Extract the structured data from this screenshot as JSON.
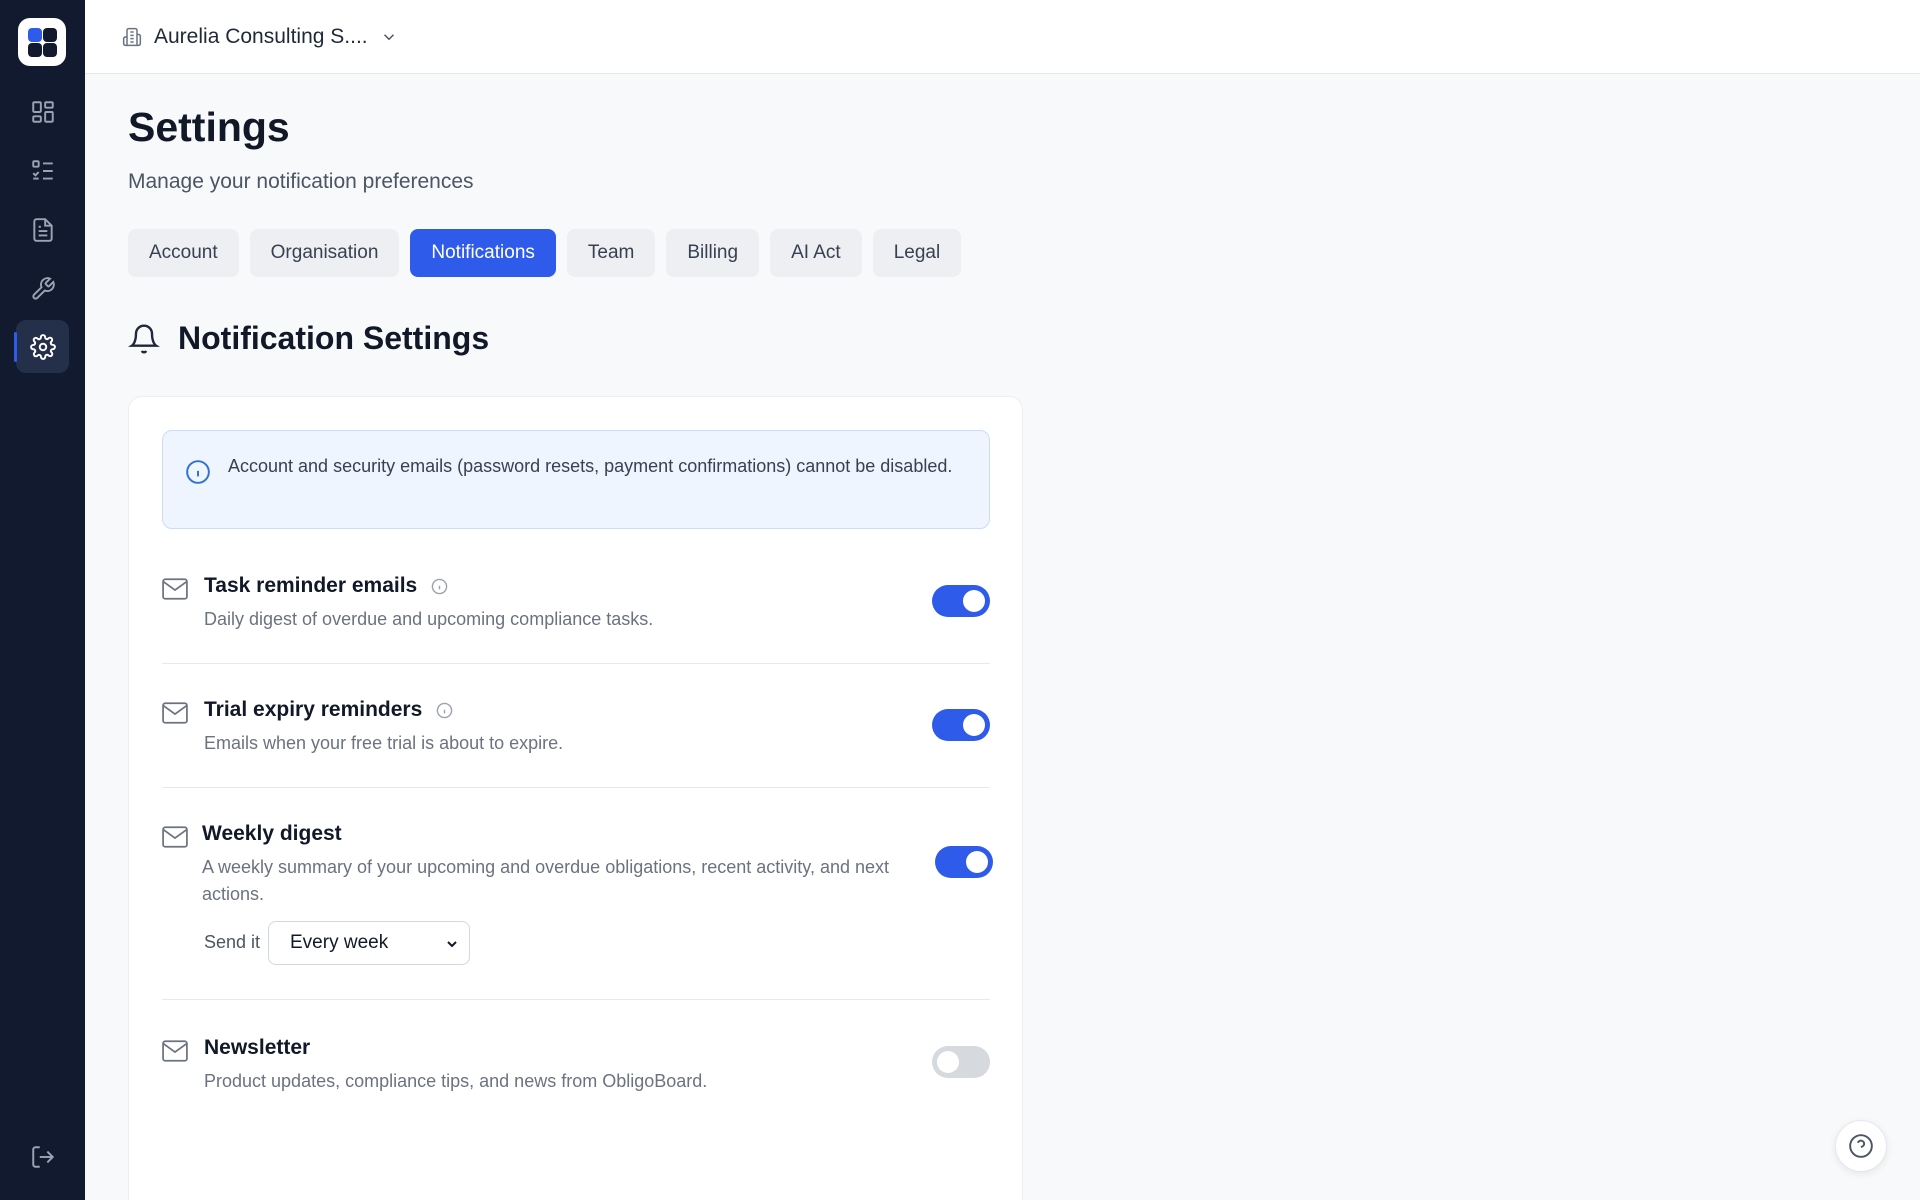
{
  "topbar": {
    "org_name": "Aurelia Consulting S...."
  },
  "page": {
    "title": "Settings",
    "subtitle": "Manage your notification preferences"
  },
  "tabs": [
    {
      "label": "Account",
      "active": false
    },
    {
      "label": "Organisation",
      "active": false
    },
    {
      "label": "Notifications",
      "active": true
    },
    {
      "label": "Team",
      "active": false
    },
    {
      "label": "Billing",
      "active": false
    },
    {
      "label": "AI Act",
      "active": false
    },
    {
      "label": "Legal",
      "active": false
    }
  ],
  "section": {
    "title": "Notification Settings"
  },
  "info_notice": "Account and security emails (password resets, payment confirmations) cannot be disabled.",
  "settings": [
    {
      "title": "Task reminder emails",
      "description": "Daily digest of overdue and upcoming compliance tasks.",
      "enabled": true
    },
    {
      "title": "Trial expiry reminders",
      "description": "Emails when your free trial is about to expire.",
      "enabled": true
    },
    {
      "title": "Weekly digest",
      "description": "A weekly summary of your upcoming and overdue obligations, recent activity, and next actions.",
      "enabled": true,
      "send_label": "Send it",
      "frequency": "Every week"
    },
    {
      "title": "Newsletter",
      "description": "Product updates, compliance tips, and news from ObligoBoard.",
      "enabled": false
    }
  ],
  "colors": {
    "sidebar": "#111a2e",
    "accent": "#2f5bea",
    "toggle_off": "#d6d9de",
    "info_bg": "#eef5fe"
  },
  "icons": {
    "sidebar": [
      "dashboard-icon",
      "task-list-icon",
      "document-icon",
      "wrench-icon",
      "gear-icon",
      "logout-icon"
    ],
    "other": [
      "building-icon",
      "chevron-down-icon",
      "bell-icon",
      "info-icon",
      "mail-icon",
      "help-icon"
    ]
  }
}
